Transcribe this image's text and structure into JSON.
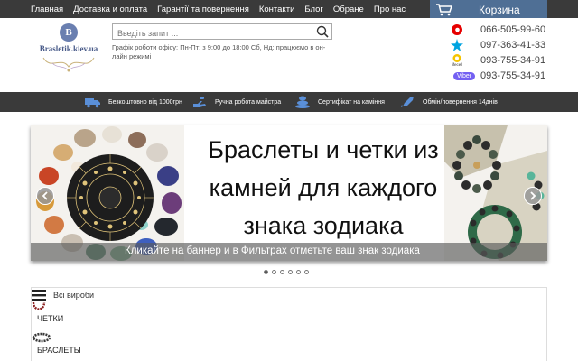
{
  "top_nav": {
    "items": [
      "Главная",
      "Доставка и оплата",
      "Гарантії та повернення",
      "Контакти",
      "Блог",
      "Обране",
      "Про нас"
    ],
    "cart_label": "Корзина"
  },
  "logo": {
    "letter": "B",
    "text": "Brasletik.kiev.ua"
  },
  "search": {
    "placeholder": "Введіть запит ..."
  },
  "schedule": "Графік роботи офісу: Пн-Пт: з 9:00 до 18:00 Сб, Нд: працюємо в он-лайн режимі",
  "phones": [
    {
      "operator_icon": "vodafone-icon",
      "number": "066-505-99-60"
    },
    {
      "operator_icon": "kyivstar-icon",
      "number": "097-363-41-33"
    },
    {
      "operator_icon": "lifecell-icon",
      "operator_text": "lifecell",
      "number": "093-755-34-91"
    },
    {
      "operator_icon": "viber-icon",
      "operator_text": "Viber",
      "number": "093-755-34-91"
    }
  ],
  "benefits": [
    {
      "icon": "truck-icon",
      "text": "Безкоштовно від 1000грн"
    },
    {
      "icon": "hand-icon",
      "text": "Ручна робота майстра"
    },
    {
      "icon": "stones-icon",
      "text": "Сертифікат на каміння"
    },
    {
      "icon": "rocket-icon",
      "text": "Обмін/повернення 14днів"
    }
  ],
  "banner": {
    "headline_lines": [
      "Браслеты и четки из",
      "камней для каждого",
      "знака зодиака"
    ],
    "caption": "Кликайте на баннер и в Фильтрах отметьте ваш знак зодиака",
    "slide_count": 6,
    "active_slide": 1
  },
  "catalog": {
    "title": "Всі вироби",
    "items": [
      {
        "icon": "rosary-icon",
        "label": "ЧЕТКИ"
      },
      {
        "icon": "bracelet-icon",
        "label": "БРАСЛЕТЫ"
      }
    ]
  },
  "colors": {
    "topbar": "#3a3a3a",
    "cart": "#4f6f95",
    "vodafone": "#e60000",
    "kyivstar": "#00a3e0",
    "lifecell": "#f5c400",
    "viber": "#7360f2"
  }
}
